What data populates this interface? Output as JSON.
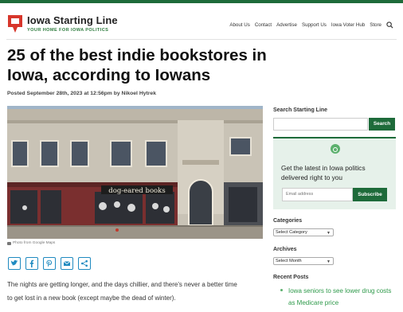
{
  "header": {
    "site_title": "Iowa Starting Line",
    "tagline": "YOUR HOME FOR IOWA POLITICS",
    "nav": [
      "About Us",
      "Contact",
      "Advertise",
      "Support Us",
      "Iowa Voter Hub",
      "Store"
    ]
  },
  "article": {
    "headline": "25 of the best indie bookstores in Iowa, according to Iowans",
    "byline": "Posted September 28th, 2023 at 12:56pm by Nikoel Hytrek",
    "image_signage": "dog-eared books",
    "photo_credit": "Photo from Google Maps",
    "share_icons": [
      "twitter-icon",
      "facebook-icon",
      "pinterest-icon",
      "email-icon",
      "share-icon"
    ],
    "body_first_line": "The nights are getting longer, and the days chillier, and there's never a better time",
    "body_second_line": "to get lost in a new book (except maybe the dead of winter)."
  },
  "sidebar": {
    "search_label": "Search Starting Line",
    "search_placeholder": "",
    "search_button": "Search",
    "newsletter_heading": "Get the latest in Iowa politics delivered right to you",
    "email_placeholder": "Email address",
    "subscribe_button": "Subscribe",
    "categories_label": "Categories",
    "categories_selected": "Select Category",
    "archives_label": "Archives",
    "archives_selected": "Select Month",
    "recent_label": "Recent Posts",
    "recent_first": "Iowa seniors to see lower drug costs as Medicare price"
  },
  "colors": {
    "brand_green": "#1e6b3a",
    "link_green": "#2f9a4b",
    "logo_red": "#d7362b",
    "share_blue": "#1f8ac0"
  }
}
